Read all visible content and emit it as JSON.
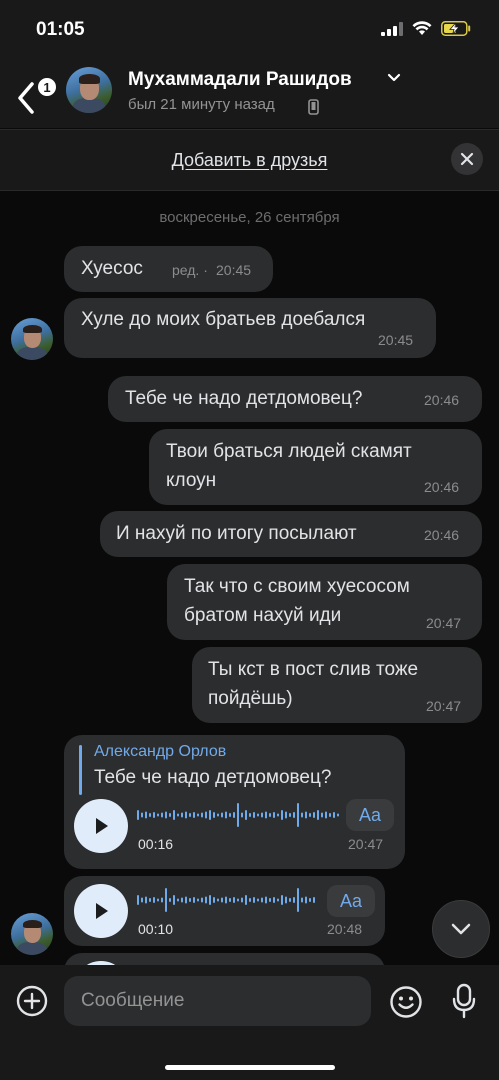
{
  "status_bar": {
    "time": "01:05"
  },
  "header": {
    "back_badge": "1",
    "name": "Мухаммадали Рашидов",
    "status": "был 21 минуту назад"
  },
  "friend_bar": {
    "link": "Добавить в друзья"
  },
  "chat": {
    "date": "воскресенье, 26 сентября",
    "messages": [
      {
        "text": "Хуесос",
        "edited": "ред. ·",
        "time": "20:45"
      },
      {
        "text": "Хуле до моих братьев доебался",
        "time": "20:45"
      },
      {
        "text": "Тебе че надо детдомовец?",
        "time": "20:46"
      },
      {
        "line1": "Твои браться людей скамят",
        "line2": "клоун",
        "time": "20:46"
      },
      {
        "text": "И нахуй по итогу посылают",
        "time": "20:46"
      },
      {
        "line1": "Так что с своим хуесосом",
        "line2": "братом нахуй иди",
        "time": "20:47"
      },
      {
        "line1": "Ты кст в пост слив тоже",
        "line2": "пойдёшь)",
        "time": "20:47"
      }
    ],
    "voice1": {
      "reply_name": "Александр Орлов",
      "reply_text": "Тебе че надо детдомовец?",
      "duration": "00:16",
      "time": "20:47",
      "aa": "Aa"
    },
    "voice2": {
      "duration": "00:10",
      "time": "20:48",
      "aa": "Aa"
    }
  },
  "composer": {
    "placeholder": "Сообщение"
  },
  "colors": {
    "accent": "#71aaeb",
    "bubble": "#2c2d2e",
    "bar": "#19191a",
    "background": "#0a0a0a"
  }
}
